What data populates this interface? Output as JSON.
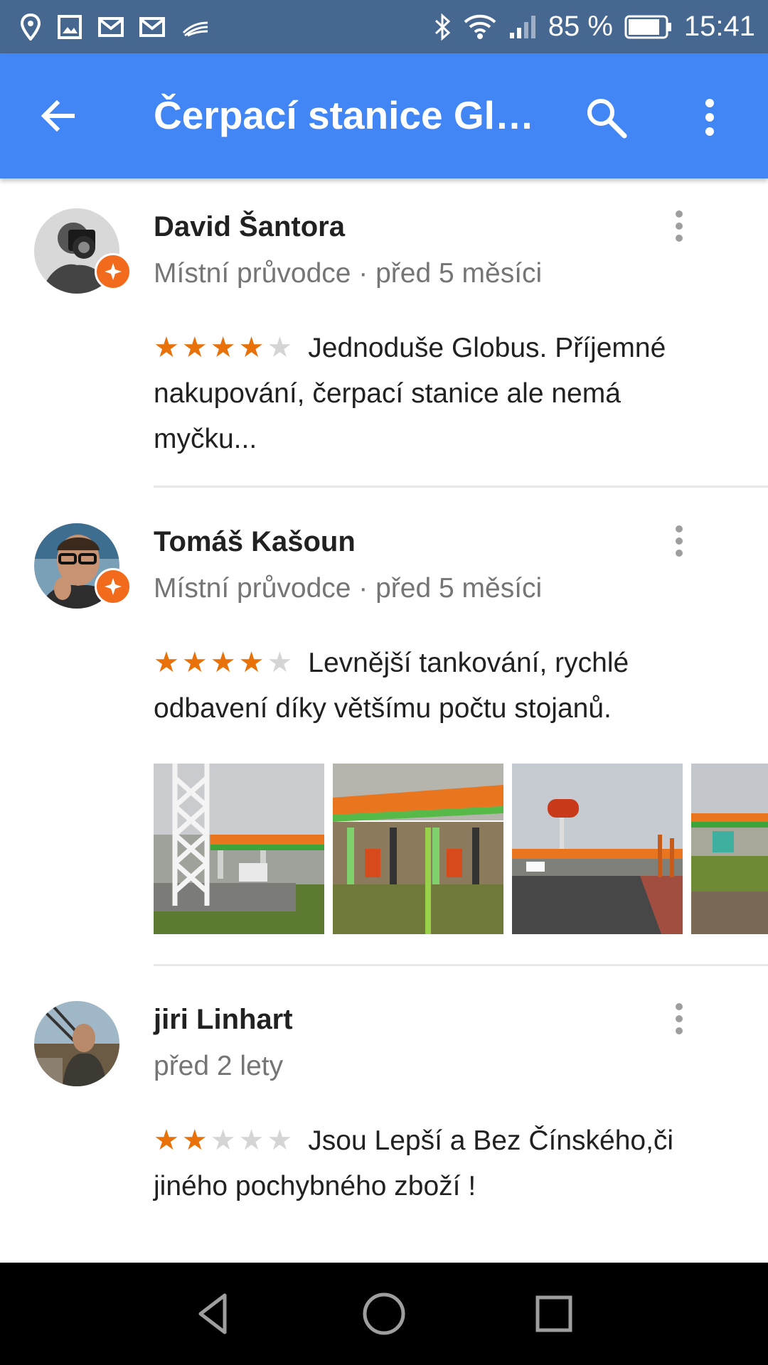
{
  "status_bar": {
    "left_icons": [
      "location-icon",
      "image-icon",
      "gmail-icon",
      "gmail-icon",
      "swipe-icon"
    ],
    "right_icons": [
      "bluetooth-icon",
      "wifi-icon",
      "signal-icon"
    ],
    "battery": "85 %",
    "battery_level": 0.85,
    "time": "15:41"
  },
  "app_bar": {
    "title": "Čerpací stanice Globus",
    "back_icon": "arrow-left-icon",
    "search_icon": "search-icon",
    "more_icon": "more-vert-icon",
    "color": "#4285f4"
  },
  "reviews": [
    {
      "author": "David Šantora",
      "meta": "Místní průvodce · před 5 měsíci",
      "local_guide": true,
      "rating": 4,
      "text": "Jednoduše Globus. Příjemné nakupování, čerpací stanice ale nemá myčku..."
    },
    {
      "author": "Tomáš Kašoun",
      "meta": "Místní průvodce · před 5 měsíci",
      "local_guide": true,
      "rating": 4,
      "text": "Levnější tankování, rychlé odbavení díky většímu počtu stojanů.",
      "photos": [
        "photo-tower-station",
        "photo-station-canopy",
        "photo-globus-sign",
        "photo-station-side"
      ]
    },
    {
      "author": "jiri Linhart",
      "meta": "před 2 lety",
      "local_guide": false,
      "rating": 2,
      "text": "Jsou Lepší a Bez Čínského,či jiného pochybného zboží !"
    }
  ],
  "colors": {
    "star_on": "#e8710a",
    "star_off": "#d5d5d5",
    "badge": "#f26b1d",
    "status_bar": "#46678f"
  },
  "nav_bar": {
    "buttons": [
      "back-triangle-icon",
      "home-circle-icon",
      "recents-square-icon"
    ]
  }
}
